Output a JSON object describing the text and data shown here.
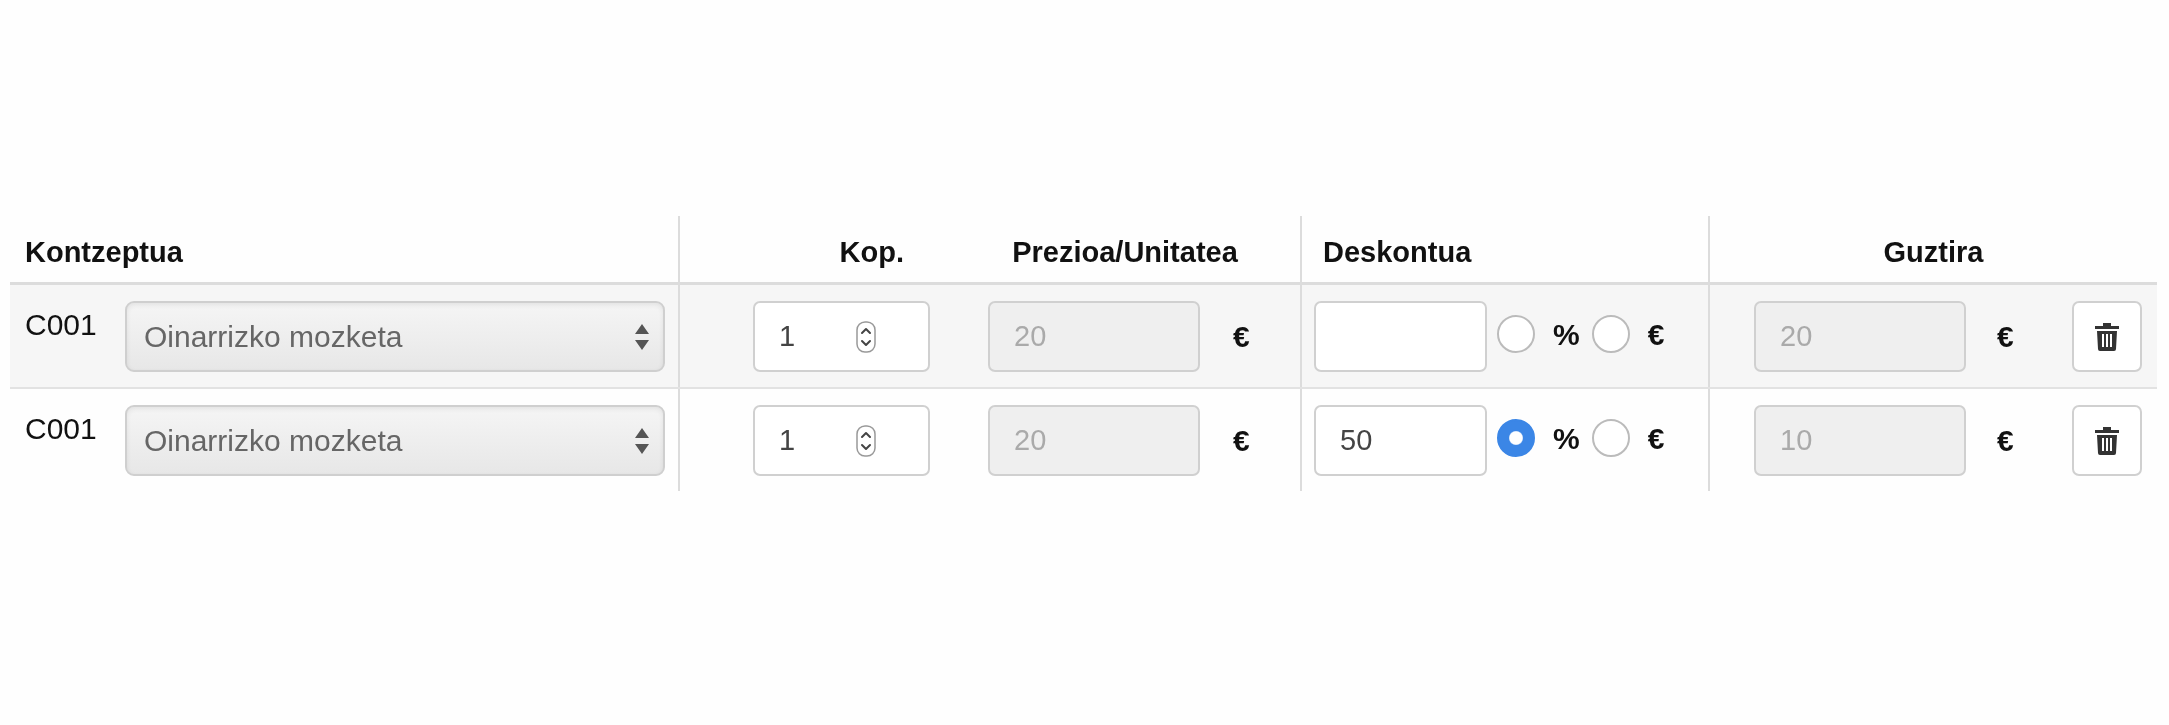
{
  "table": {
    "columns": [
      {
        "label": "Kontzeptua"
      },
      {
        "label": "Kop."
      },
      {
        "label": "Prezioa/Unitatea"
      },
      {
        "label": "Deskontua"
      },
      {
        "label": "Guztira"
      }
    ],
    "rows": [
      {
        "code": "C001",
        "concept": "Oinarrizko mozketa",
        "quantity": "1",
        "unit_price": {
          "value": "20",
          "disabled": true
        },
        "unit_price_currency": "€",
        "discount": {
          "options": [
            {
              "label": "%",
              "selected": false
            },
            {
              "label": "€",
              "selected": false
            }
          ]
        },
        "total": {
          "value": "20",
          "disabled": true
        },
        "total_currency": "€"
      },
      {
        "code": "C001",
        "concept": "Oinarrizko mozketa",
        "quantity": "1",
        "unit_price": {
          "value": "20",
          "disabled": true
        },
        "unit_price_currency": "€",
        "discount": {
          "value": "50",
          "options": [
            {
              "label": "%",
              "selected": true
            },
            {
              "label": "€",
              "selected": false
            }
          ]
        },
        "total": {
          "value": "10",
          "disabled": true
        },
        "total_currency": "€"
      }
    ]
  }
}
